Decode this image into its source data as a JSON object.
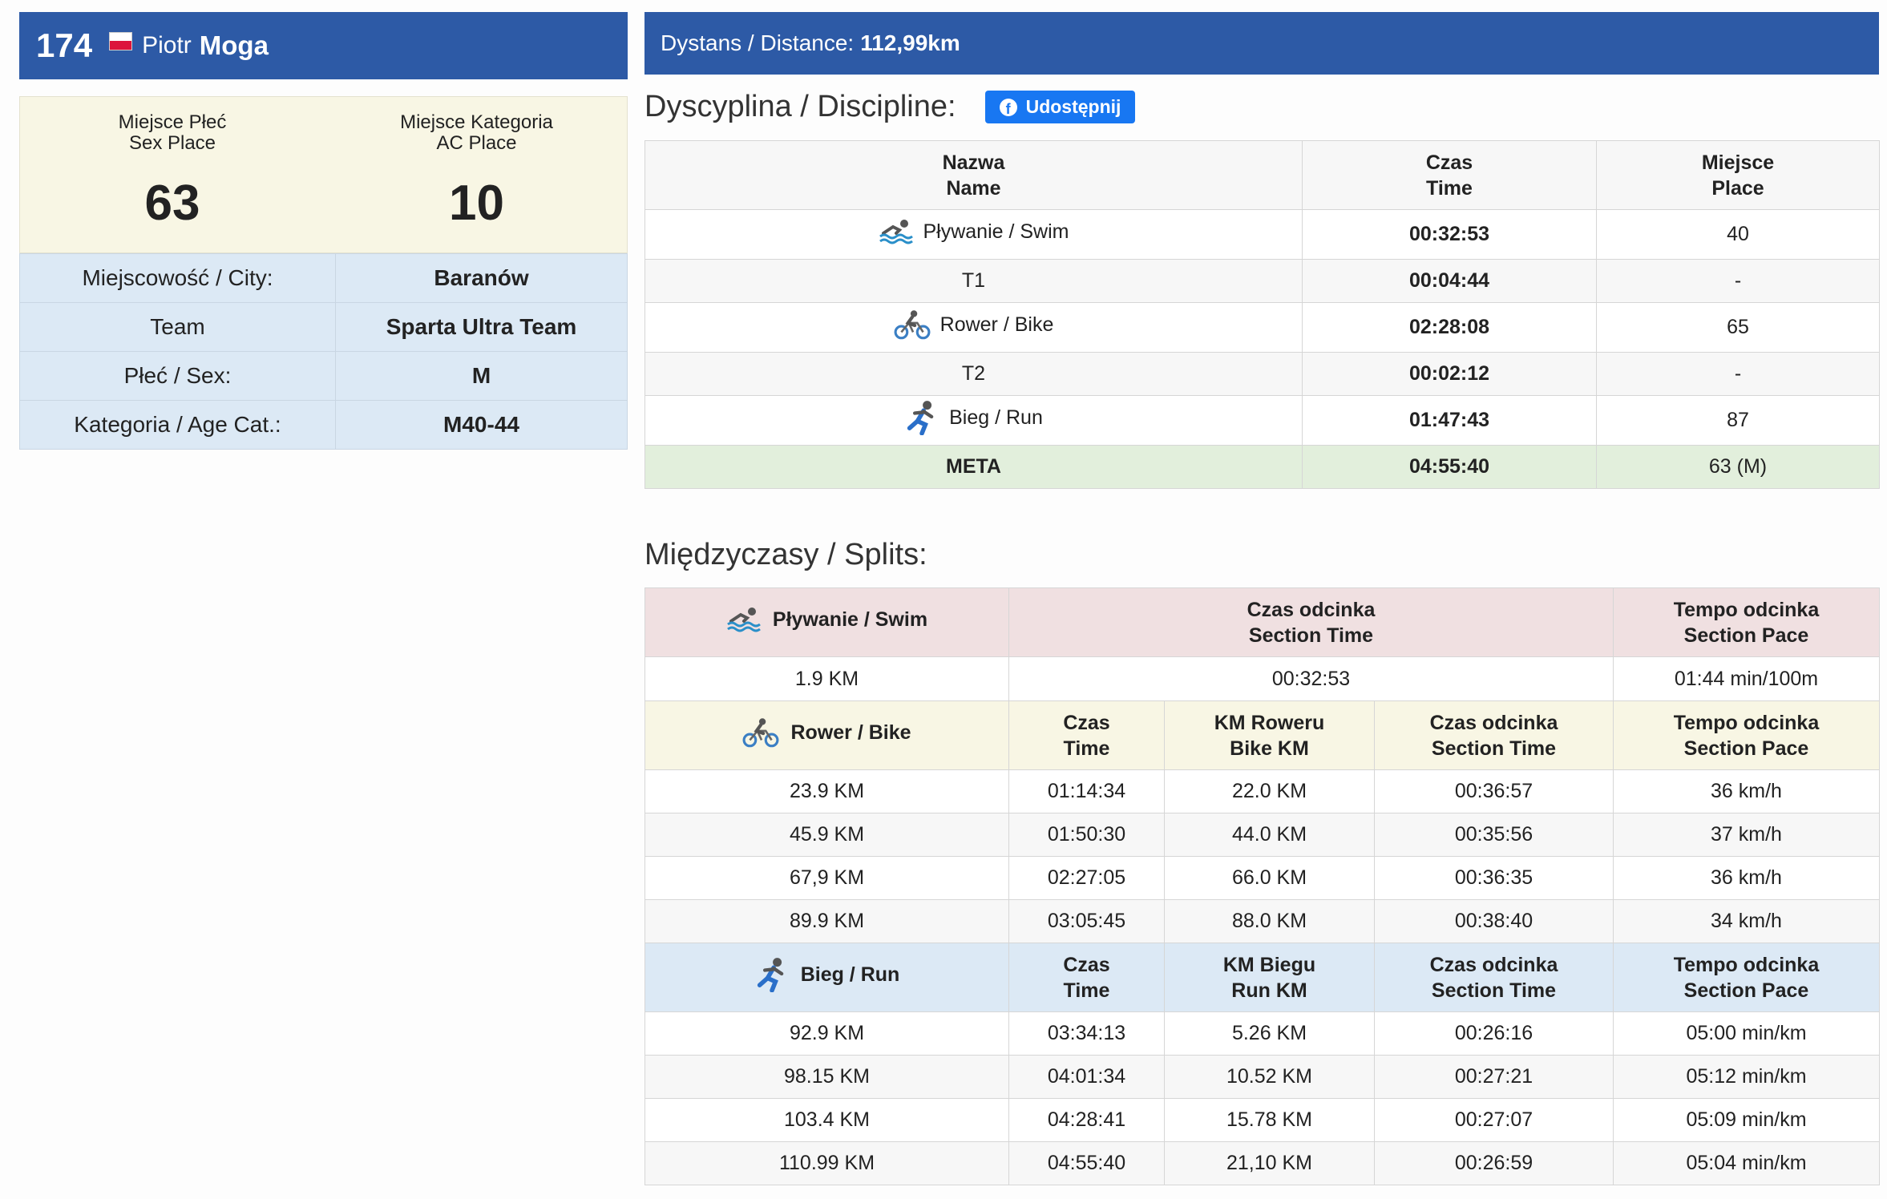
{
  "athlete": {
    "bib": "174",
    "first_name": "Piotr",
    "last_name": "Moga",
    "flag": "Poland"
  },
  "places": {
    "sex": {
      "label_pl": "Miejsce Płeć",
      "label_en": "Sex Place",
      "value": "63"
    },
    "category": {
      "label_pl": "Miejsce Kategoria",
      "label_en": "AC Place",
      "value": "10"
    }
  },
  "info": [
    {
      "key": "Miejscowość / City:",
      "value": "Baranów"
    },
    {
      "key": "Team",
      "value": "Sparta Ultra Team"
    },
    {
      "key": "Płeć / Sex:",
      "value": "M"
    },
    {
      "key": "Kategoria / Age Cat.:",
      "value": "M40-44"
    }
  ],
  "distance": {
    "label": "Dystans / Distance:",
    "value": "112,99km"
  },
  "discipline": {
    "title": "Dyscyplina / Discipline:",
    "share_label": "Udostępnij",
    "headers": {
      "name_pl": "Nazwa",
      "name_en": "Name",
      "time_pl": "Czas",
      "time_en": "Time",
      "place_pl": "Miejsce",
      "place_en": "Place"
    },
    "rows": [
      {
        "name": "Pływanie / Swim",
        "time": "00:32:53",
        "place": "40",
        "icon": "swim-icon"
      },
      {
        "name": "T1",
        "time": "00:04:44",
        "place": "-"
      },
      {
        "name": "Rower / Bike",
        "time": "02:28:08",
        "place": "65",
        "icon": "bike-icon"
      },
      {
        "name": "T2",
        "time": "00:02:12",
        "place": "-"
      },
      {
        "name": "Bieg / Run",
        "time": "01:47:43",
        "place": "87",
        "icon": "run-icon"
      }
    ],
    "meta": {
      "name": "META",
      "time": "04:55:40",
      "place": "63 (M)"
    }
  },
  "splits": {
    "title": "Międzyczasy / Splits:",
    "swim": {
      "label": "Pływanie / Swim",
      "h_section_time": [
        "Czas odcinka",
        "Section Time"
      ],
      "h_section_pace": [
        "Tempo odcinka",
        "Section Pace"
      ],
      "row": {
        "km": "1.9 KM",
        "section_time": "00:32:53",
        "pace": "01:44 min/100m"
      }
    },
    "bike": {
      "label": "Rower / Bike",
      "h_time": [
        "Czas",
        "Time"
      ],
      "h_km": [
        "KM Roweru",
        "Bike KM"
      ],
      "h_section_time": [
        "Czas odcinka",
        "Section Time"
      ],
      "h_section_pace": [
        "Tempo odcinka",
        "Section Pace"
      ],
      "rows": [
        {
          "km": "23.9 KM",
          "time": "01:14:34",
          "seg_km": "22.0 KM",
          "section_time": "00:36:57",
          "pace": "36 km/h"
        },
        {
          "km": "45.9 KM",
          "time": "01:50:30",
          "seg_km": "44.0 KM",
          "section_time": "00:35:56",
          "pace": "37 km/h"
        },
        {
          "km": "67,9 KM",
          "time": "02:27:05",
          "seg_km": "66.0 KM",
          "section_time": "00:36:35",
          "pace": "36 km/h"
        },
        {
          "km": "89.9 KM",
          "time": "03:05:45",
          "seg_km": "88.0 KM",
          "section_time": "00:38:40",
          "pace": "34 km/h"
        }
      ]
    },
    "run": {
      "label": "Bieg / Run",
      "h_time": [
        "Czas",
        "Time"
      ],
      "h_km": [
        "KM Biegu",
        "Run KM"
      ],
      "h_section_time": [
        "Czas odcinka",
        "Section Time"
      ],
      "h_section_pace": [
        "Tempo odcinka",
        "Section Pace"
      ],
      "rows": [
        {
          "km": "92.9 KM",
          "time": "03:34:13",
          "seg_km": "5.26 KM",
          "section_time": "00:26:16",
          "pace": "05:00 min/km"
        },
        {
          "km": "98.15 KM",
          "time": "04:01:34",
          "seg_km": "10.52 KM",
          "section_time": "00:27:21",
          "pace": "05:12 min/km"
        },
        {
          "km": "103.4 KM",
          "time": "04:28:41",
          "seg_km": "15.78 KM",
          "section_time": "00:27:07",
          "pace": "05:09 min/km"
        },
        {
          "km": "110.99 KM",
          "time": "04:55:40",
          "seg_km": "21,10 KM",
          "section_time": "00:26:59",
          "pace": "05:04 min/km"
        }
      ]
    }
  },
  "colors": {
    "header_blue": "#2d5aa6",
    "facebook_blue": "#1877f2",
    "swim_bg": "#f0e0e1",
    "bike_bg": "#f8f6e4",
    "run_bg": "#dce9f5",
    "meta_bg": "#e2efdc"
  }
}
